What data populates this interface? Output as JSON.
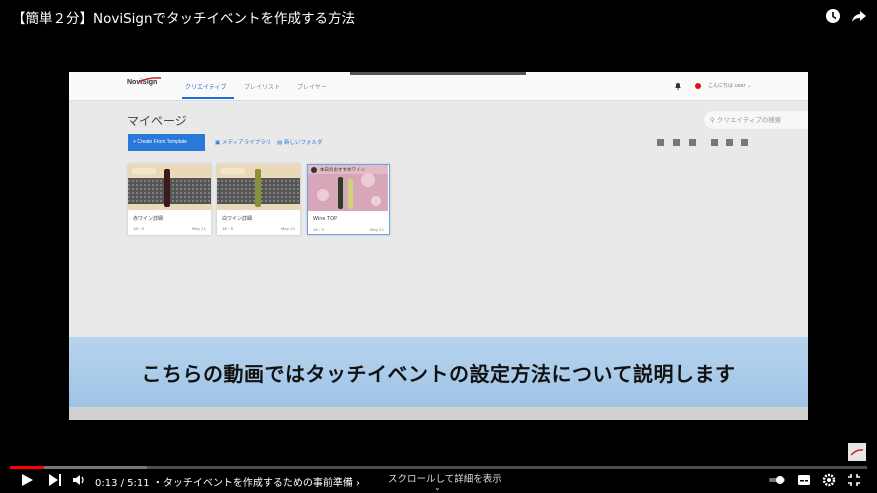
{
  "video": {
    "title": "【簡単２分】NoviSignでタッチイベントを作成する方法",
    "time": "0:13 / 5:11",
    "chapter": "・タッチイベントを作成するための事前準備 ›",
    "scroll_hint": "スクロールして詳細を表示",
    "scroll_chevron": "⌄",
    "caption": "こちらの動画ではタッチイベントの設定方法について説明します",
    "progress_played": 0.04,
    "progress_buffered": 0.16
  },
  "app": {
    "logo": "NoviSign",
    "tabs": [
      "クリエイティブ",
      "プレイリスト",
      "プレイヤー"
    ],
    "user": "こんにちは user ⌄",
    "page_title": "マイページ",
    "search_placeholder": "クリエイティブの検索",
    "create_button": "+ Create From Template",
    "media_library": "メディアライブラリ",
    "new_folder": "新しいフォルダ",
    "cards": [
      {
        "name": "赤ワイン詳細",
        "meta": "16 : 9",
        "date": "May 21"
      },
      {
        "name": "白ワイン詳細",
        "meta": "16 : 9",
        "date": "May 21"
      },
      {
        "name": "Wine TOP",
        "meta": "16 : 9",
        "date": "May 21",
        "badge": "本日のおすすめワイン"
      }
    ]
  },
  "colors": {
    "accent": "#2a79d9",
    "progress": "#ff0000",
    "banner": "#b7d4ef"
  }
}
